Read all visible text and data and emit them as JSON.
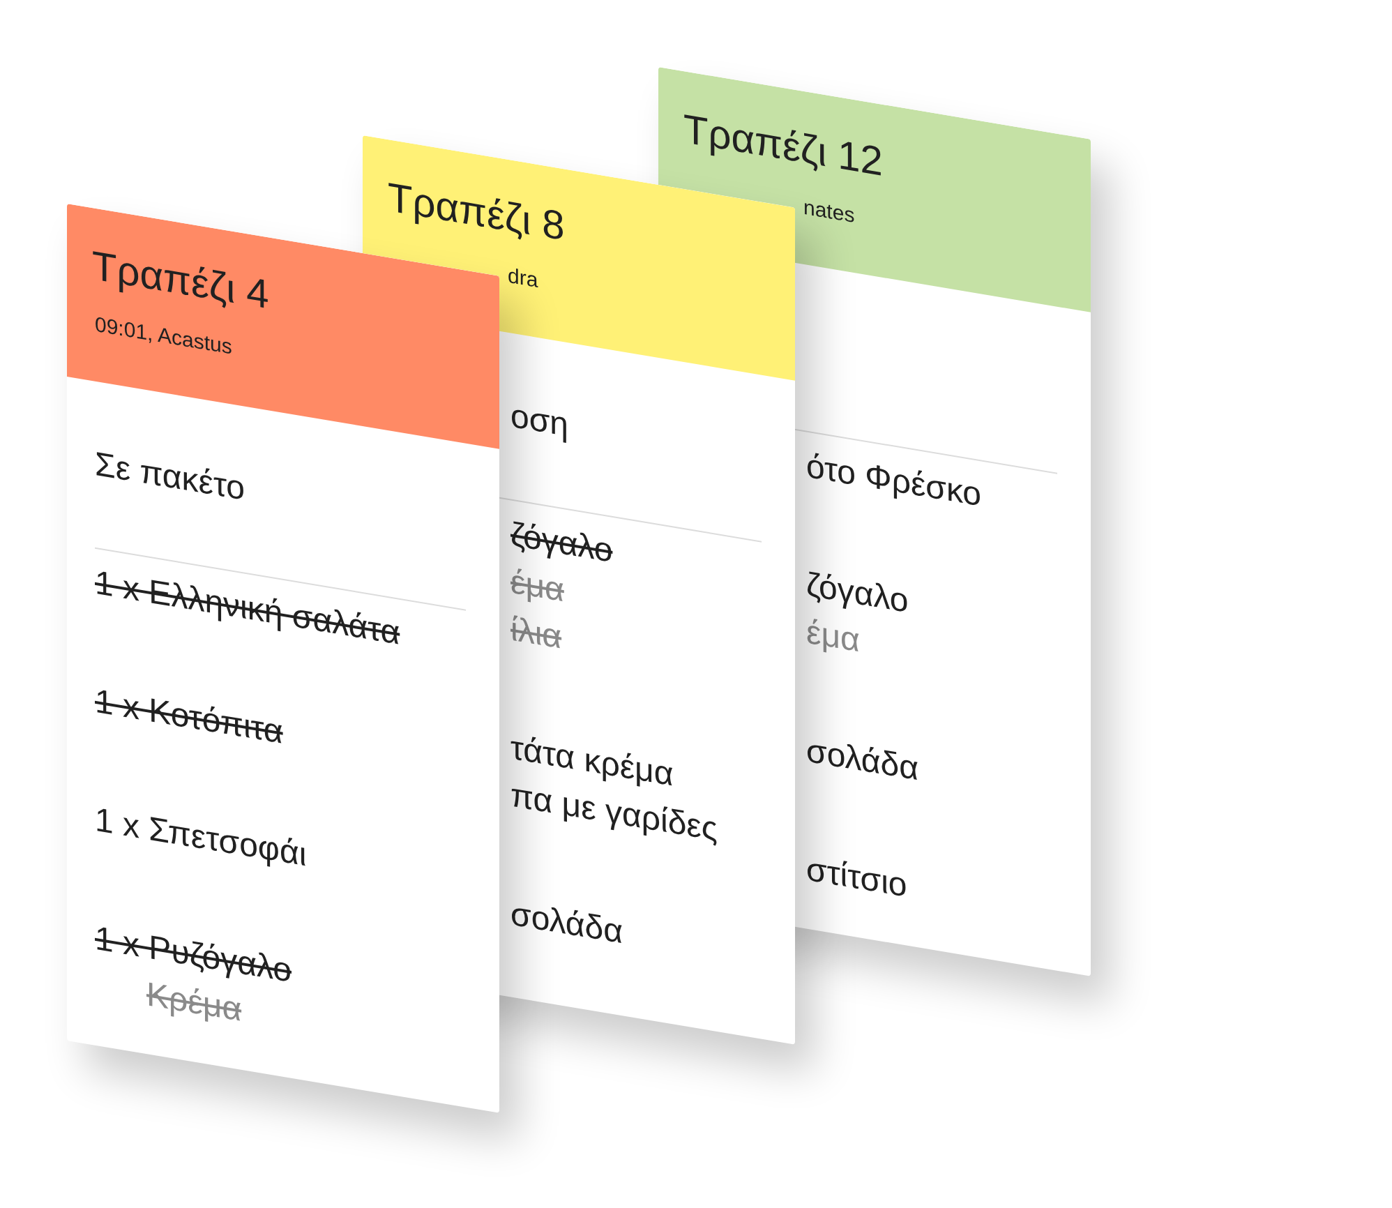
{
  "cards": [
    {
      "title": "Τραπέζι 4",
      "subtitle": "09:01, Acastus",
      "color": "#ff8a65",
      "note": "Σε πακέτο",
      "items": [
        {
          "lines": [
            "1 x Ελληνική σαλάτα"
          ],
          "done": true
        },
        {
          "lines": [
            "1 x Κοτόπιτα"
          ],
          "done": true
        },
        {
          "lines": [
            "1 x Σπετσοφάι"
          ],
          "done": false
        },
        {
          "lines": [
            "1 x Ρυζόγαλο"
          ],
          "done": true,
          "modifiers": [
            "Κρέμα"
          ]
        }
      ]
    },
    {
      "title": "Τραπέζι 8",
      "subtitle": "dra",
      "color": "#fff176",
      "note": "οση",
      "items": [
        {
          "lines": [
            "ζόγαλο"
          ],
          "done": true,
          "modifiers": [
            "έμα",
            "ίλια"
          ]
        },
        {
          "lines": [
            "τάτα κρέμα",
            "πα με γαρίδες"
          ],
          "done": false
        },
        {
          "lines": [
            "σολάδα"
          ],
          "done": false
        }
      ]
    },
    {
      "title": "Τραπέζι 12",
      "subtitle": "nates",
      "color": "#c5e1a5",
      "items": [
        {
          "lines": [
            "ότο Φρέσκο"
          ],
          "done": false
        },
        {
          "lines": [
            "ζόγαλο"
          ],
          "done": false,
          "modifiers": [
            "έμα"
          ]
        },
        {
          "lines": [
            "σολάδα"
          ],
          "done": false
        },
        {
          "lines": [
            "στίτσιο"
          ],
          "done": false
        }
      ]
    }
  ]
}
